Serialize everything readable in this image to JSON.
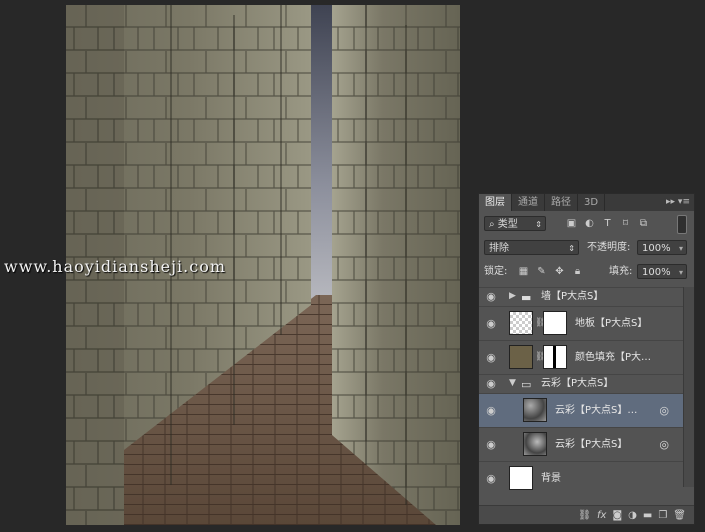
{
  "watermark": "www.haoyidiansheji.com",
  "panel": {
    "tabs": [
      {
        "label": "图层"
      },
      {
        "label": "通道"
      },
      {
        "label": "路径"
      },
      {
        "label": "3D"
      }
    ],
    "filter_label": "类型",
    "blend_mode": "排除",
    "opacity_label": "不透明度:",
    "opacity_value": "100%",
    "lock_label": "锁定:",
    "fill_label": "填充:",
    "fill_value": "100%",
    "layers": [
      {
        "name": "墙【P大点S】",
        "type": "group"
      },
      {
        "name": "地板【P大点S】",
        "type": "image"
      },
      {
        "name": "颜色填充【P大…",
        "type": "fill"
      },
      {
        "name": "云彩【P大点S】",
        "type": "group"
      },
      {
        "name": "云彩【P大点S】…",
        "type": "smart",
        "selected": true
      },
      {
        "name": "云彩【P大点S】",
        "type": "smart"
      },
      {
        "name": "背景",
        "type": "background"
      }
    ]
  },
  "icons": {
    "eye": "eye-icon",
    "folder": "folder-icon",
    "link": "link-icon"
  },
  "colors": {
    "panel_bg": "#535353",
    "selected_row": "#606c7e",
    "fill_color": "#6b6147"
  }
}
